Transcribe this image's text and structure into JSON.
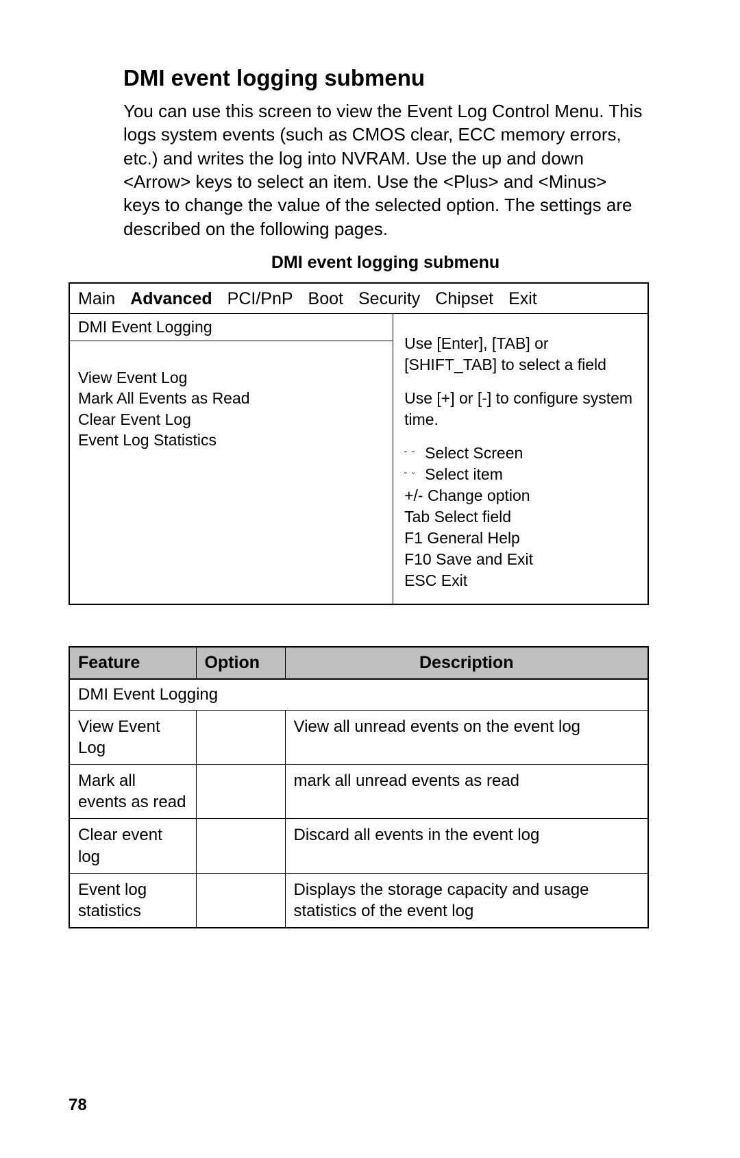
{
  "title": "DMI event logging submenu",
  "intro": "You can use this screen to view the Event Log Control Menu. This logs system events (such as CMOS clear, ECC memory errors, etc.) and writes the log into NVRAM. Use the up and down <Arrow> keys to select an item. Use the <Plus> and <Minus> keys to change the value of the selected option. The settings are described on the following pages.",
  "subtitle": "DMI event logging submenu",
  "bios": {
    "tabs": [
      "Main",
      "Advanced",
      "PCI/PnP",
      "Boot",
      "Security",
      "Chipset",
      "Exit"
    ],
    "active_tab_index": 1,
    "section_header": "DMI Event Logging",
    "items": [
      "View Event Log",
      "Mark All Events as Read",
      "Clear Event Log",
      "Event Log Statistics"
    ],
    "help1": "Use [Enter], [TAB] or [SHIFT_TAB] to select a field",
    "help2": "Use [+] or [-] to configure system time.",
    "hints": {
      "arrow_lr": "Select Screen",
      "arrow_ud": "Select item",
      "plusminus": "+/-  Change option",
      "tab": "Tab  Select field",
      "f1": "F1  General Help",
      "f10": "F10  Save and Exit",
      "esc": "ESC Exit"
    }
  },
  "table": {
    "headers": {
      "feature": "Feature",
      "option": "Option",
      "description": "Description"
    },
    "subhead": "DMI Event Logging",
    "rows": [
      {
        "feature": "View Event Log",
        "option": "",
        "description": "View all unread events on the event log"
      },
      {
        "feature": "Mark all events as read",
        "option": "",
        "description": "mark all unread events as read"
      },
      {
        "feature": "Clear event log",
        "option": "",
        "description": "Discard all events in the event log"
      },
      {
        "feature": "Event log statistics",
        "option": "",
        "description": "Displays the storage capacity and usage statistics of the event log"
      }
    ]
  },
  "page_number": "78"
}
